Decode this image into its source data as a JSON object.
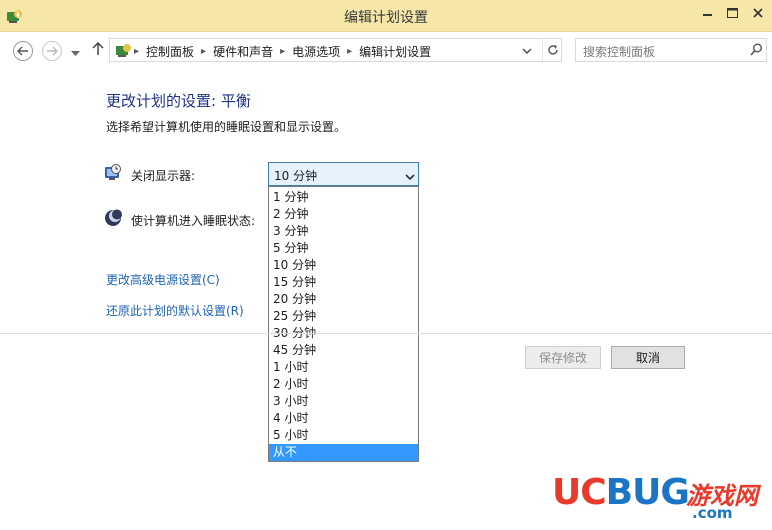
{
  "window": {
    "title": "编辑计划设置"
  },
  "nav": {
    "breadcrumbs": [
      "控制面板",
      "硬件和声音",
      "电源选项",
      "编辑计划设置"
    ],
    "search_placeholder": "搜索控制面板"
  },
  "main": {
    "heading": "更改计划的设置: 平衡",
    "subheading": "选择希望计算机使用的睡眠设置和显示设置。",
    "display_label": "关闭显示器:",
    "sleep_label": "使计算机进入睡眠状态:",
    "display_selected": "10 分钟",
    "dropdown_options": [
      "1 分钟",
      "2 分钟",
      "3 分钟",
      "5 分钟",
      "10 分钟",
      "15 分钟",
      "20 分钟",
      "25 分钟",
      "30 分钟",
      "45 分钟",
      "1 小时",
      "2 小时",
      "3 小时",
      "4 小时",
      "5 小时",
      "从不"
    ],
    "highlighted_option": "从不",
    "link_advanced": "更改高级电源设置(C)",
    "link_restore": "还原此计划的默认设置(R)",
    "save_button": "保存修改",
    "cancel_button": "取消"
  },
  "watermark": {
    "brand_uc": "UC",
    "brand_bug": "BUG",
    "brand_cn": "游戏网",
    "domain": ".com"
  },
  "colors": {
    "titlebar": "#f6e7a9",
    "heading": "#1e3287",
    "link": "#1e64b4",
    "selection": "#3399ff"
  },
  "icons": [
    "app-power-icon",
    "minimize-icon",
    "maximize-icon",
    "close-icon",
    "back-arrow-icon",
    "forward-arrow-icon",
    "recent-dropdown-icon",
    "up-arrow-icon",
    "control-panel-icon",
    "chevron-down-icon",
    "refresh-icon",
    "search-icon",
    "display-timer-icon",
    "sleep-moon-icon"
  ]
}
